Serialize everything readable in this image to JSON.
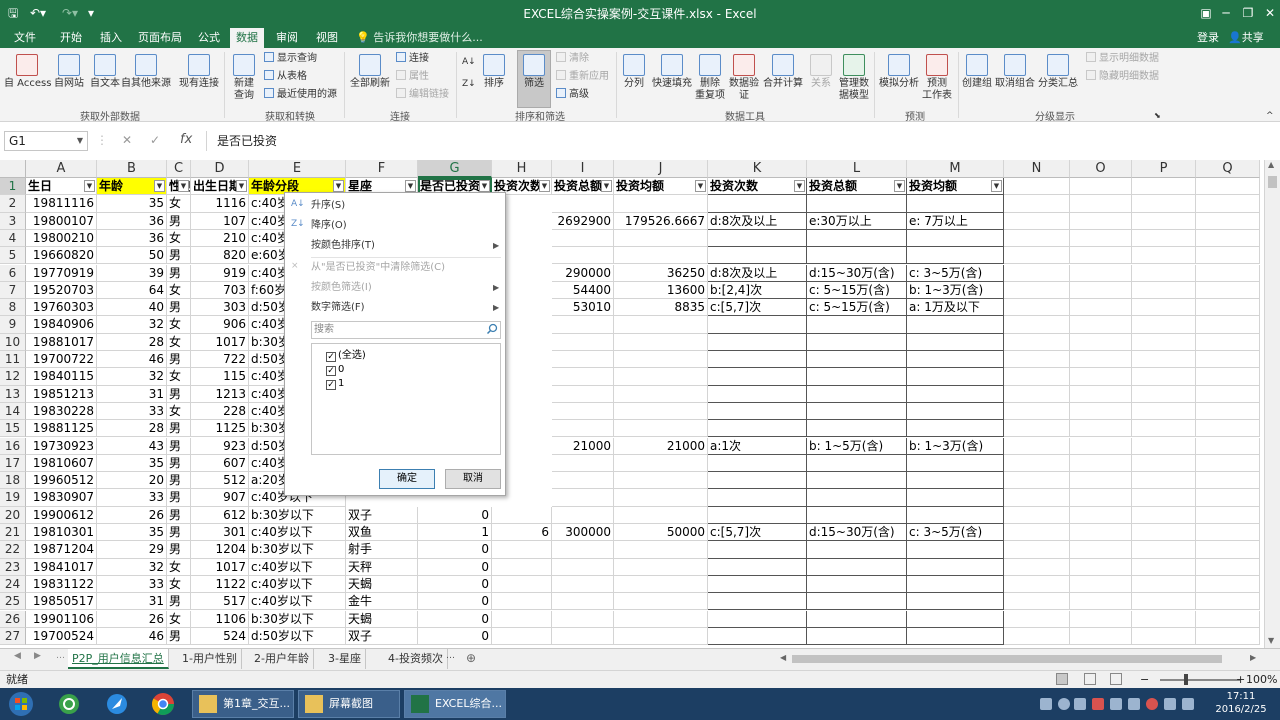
{
  "window": {
    "title": "EXCEL综合实操案例-交互课件.xlsx - Excel"
  },
  "ribbon_tabs": [
    "文件",
    "开始",
    "插入",
    "页面布局",
    "公式",
    "数据",
    "审阅",
    "视图"
  ],
  "tell_me": "告诉我你想要做什么...",
  "account": {
    "login": "登录",
    "share": "共享"
  },
  "ribbon": {
    "get_external": [
      "自 Access",
      "自网站",
      "自文本",
      "自其他来源",
      "现有连接"
    ],
    "get_external_group": "获取外部数据",
    "new_query": "新建\n查询",
    "show_query": "显示查询",
    "from_table": "从表格",
    "recent_sources": "最近使用的源",
    "transform_group": "获取和转换",
    "refresh_all": "全部刷新",
    "connections": "连接",
    "properties": "属性",
    "edit_links": "编辑链接",
    "connections_group": "连接",
    "sort_az": "AZ",
    "sort": "排序",
    "filter": "筛选",
    "clear": "清除",
    "reapply": "重新应用",
    "advanced": "高级",
    "sort_filter_group": "排序和筛选",
    "data_tools": [
      "分列",
      "快速填充",
      "删除\n重复项",
      "数据验\n证",
      "合并计算",
      "关系",
      "管理数\n据模型"
    ],
    "data_tools_group": "数据工具",
    "forecast": [
      "模拟分析",
      "预测\n工作表"
    ],
    "forecast_group": "预测",
    "outline": [
      "创建组",
      "取消组合",
      "分类汇总"
    ],
    "show_detail": "显示明细数据",
    "hide_detail": "隐藏明细数据",
    "outline_group": "分级显示"
  },
  "formula_bar": {
    "name_box": "G1",
    "fx": "fx",
    "content": "是否已投资"
  },
  "columns": [
    "A",
    "B",
    "C",
    "D",
    "E",
    "F",
    "G",
    "H",
    "I",
    "J",
    "K",
    "L",
    "M",
    "N",
    "O",
    "P",
    "Q"
  ],
  "rows": [
    [
      "生日",
      "年龄",
      "性别",
      "出生日期",
      "年龄分段",
      "星座",
      "是否已投资",
      "投资次数",
      "投资总额",
      "投资均额",
      "投资次数",
      "投资总额",
      "投资均额"
    ],
    [
      "19811116",
      "35",
      "女",
      "1116",
      "c:40岁以下",
      "",
      "",
      "",
      "",
      "",
      "",
      "",
      ""
    ],
    [
      "19800107",
      "36",
      "男",
      "107",
      "c:40岁以下",
      "",
      "",
      "15",
      "2692900",
      "179526.6667",
      "d:8次及以上",
      "e:30万以上",
      "e: 7万以上"
    ],
    [
      "19800210",
      "36",
      "女",
      "210",
      "c:40岁以下",
      "",
      "",
      "",
      "",
      "",
      "",
      "",
      ""
    ],
    [
      "19660820",
      "50",
      "男",
      "820",
      "e:60岁以下",
      "",
      "",
      "",
      "",
      "",
      "",
      "",
      ""
    ],
    [
      "19770919",
      "39",
      "男",
      "919",
      "c:40岁以下",
      "",
      "",
      "8",
      "290000",
      "36250",
      "d:8次及以上",
      "d:15~30万(含)",
      "c: 3~5万(含)"
    ],
    [
      "19520703",
      "64",
      "女",
      "703",
      "f:60岁以上",
      "",
      "",
      "4",
      "54400",
      "13600",
      "b:[2,4]次",
      "c: 5~15万(含)",
      "b: 1~3万(含)"
    ],
    [
      "19760303",
      "40",
      "男",
      "303",
      "d:50岁以下",
      "",
      "",
      "6",
      "53010",
      "8835",
      "c:[5,7]次",
      "c: 5~15万(含)",
      "a: 1万及以下"
    ],
    [
      "19840906",
      "32",
      "女",
      "906",
      "c:40岁以下",
      "",
      "",
      "",
      "",
      "",
      "",
      "",
      ""
    ],
    [
      "19881017",
      "28",
      "女",
      "1017",
      "b:30岁以下",
      "",
      "",
      "",
      "",
      "",
      "",
      "",
      ""
    ],
    [
      "19700722",
      "46",
      "男",
      "722",
      "d:50岁以下",
      "",
      "",
      "",
      "",
      "",
      "",
      "",
      ""
    ],
    [
      "19840115",
      "32",
      "女",
      "115",
      "c:40岁以下",
      "",
      "",
      "",
      "",
      "",
      "",
      "",
      ""
    ],
    [
      "19851213",
      "31",
      "男",
      "1213",
      "c:40岁以下",
      "",
      "",
      "",
      "",
      "",
      "",
      "",
      ""
    ],
    [
      "19830228",
      "33",
      "女",
      "228",
      "c:40岁以下",
      "",
      "",
      "",
      "",
      "",
      "",
      "",
      ""
    ],
    [
      "19881125",
      "28",
      "男",
      "1125",
      "b:30岁以下",
      "",
      "",
      "",
      "",
      "",
      "",
      "",
      ""
    ],
    [
      "19730923",
      "43",
      "男",
      "923",
      "d:50岁以下",
      "",
      "",
      "1",
      "21000",
      "21000",
      "a:1次",
      "b: 1~5万(含)",
      "b: 1~3万(含)"
    ],
    [
      "19810607",
      "35",
      "男",
      "607",
      "c:40岁以下",
      "",
      "",
      "",
      "",
      "",
      "",
      "",
      ""
    ],
    [
      "19960512",
      "20",
      "男",
      "512",
      "a:20岁以下",
      "",
      "",
      "",
      "",
      "",
      "",
      "",
      ""
    ],
    [
      "19830907",
      "33",
      "男",
      "907",
      "c:40岁以下",
      "处女",
      "",
      "",
      "",
      "",
      "",
      "",
      ""
    ],
    [
      "19900612",
      "26",
      "男",
      "612",
      "b:30岁以下",
      "双子",
      "0",
      "",
      "",
      "",
      "",
      "",
      ""
    ],
    [
      "19810301",
      "35",
      "男",
      "301",
      "c:40岁以下",
      "双鱼",
      "1",
      "6",
      "300000",
      "50000",
      "c:[5,7]次",
      "d:15~30万(含)",
      "c: 3~5万(含)"
    ],
    [
      "19871204",
      "29",
      "男",
      "1204",
      "b:30岁以下",
      "射手",
      "0",
      "",
      "",
      "",
      "",
      "",
      ""
    ],
    [
      "19841017",
      "32",
      "女",
      "1017",
      "c:40岁以下",
      "天秤",
      "0",
      "",
      "",
      "",
      "",
      "",
      ""
    ],
    [
      "19831122",
      "33",
      "女",
      "1122",
      "c:40岁以下",
      "天蝎",
      "0",
      "",
      "",
      "",
      "",
      "",
      ""
    ],
    [
      "19850517",
      "31",
      "男",
      "517",
      "c:40岁以下",
      "金牛",
      "0",
      "",
      "",
      "",
      "",
      "",
      ""
    ],
    [
      "19901106",
      "26",
      "女",
      "1106",
      "b:30岁以下",
      "天蝎",
      "0",
      "",
      "",
      "",
      "",
      "",
      ""
    ],
    [
      "19700524",
      "46",
      "男",
      "524",
      "d:50岁以下",
      "双子",
      "0",
      "",
      "",
      "",
      "",
      "",
      ""
    ]
  ],
  "filter_popup": {
    "sort_asc": "升序(S)",
    "sort_desc": "降序(O)",
    "sort_color": "按颜色排序(T)",
    "clear_filter": "从\"是否已投资\"中清除筛选(C)",
    "filter_color": "按颜色筛选(I)",
    "number_filter": "数字筛选(F)",
    "search_placeholder": "搜索",
    "items": [
      "(全选)",
      "0",
      "1"
    ],
    "ok": "确定",
    "cancel": "取消"
  },
  "sheet_tabs": [
    "P2P_用户信息汇总",
    "1-用户性别",
    "2-用户年龄",
    "3-星座",
    "4-投资频次"
  ],
  "status": {
    "ready": "就绪",
    "zoom": "100%"
  },
  "taskbar": {
    "apps": [
      "第1章_交互...",
      "屏幕截图",
      "EXCEL综合..."
    ],
    "time": "17:11",
    "date": "2016/2/25"
  },
  "colors": {
    "excel_green": "#217346",
    "header_yellow": "#ffff00",
    "taskbar": "#1c3e63"
  }
}
